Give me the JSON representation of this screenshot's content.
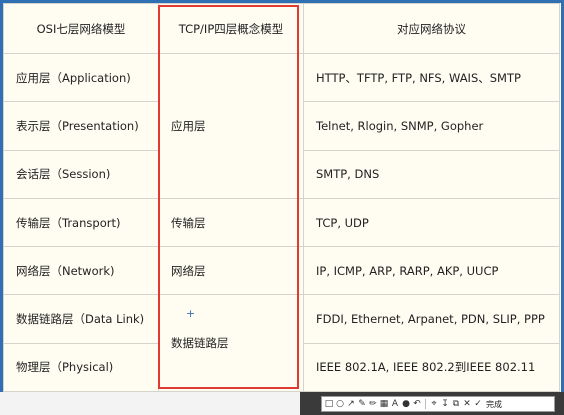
{
  "table": {
    "headers": [
      "OSI七层网络模型",
      "TCP/IP四层概念模型",
      "对应网络协议"
    ],
    "rows": [
      {
        "osi": "应用层（Application)",
        "protocols": "HTTP、TFTP, FTP, NFS, WAIS、SMTP"
      },
      {
        "osi": "表示层（Presentation)",
        "protocols": "Telnet, Rlogin, SNMP, Gopher"
      },
      {
        "osi": "会话层（Session)",
        "protocols": "SMTP, DNS"
      },
      {
        "osi": "传输层（Transport)",
        "protocols": "TCP, UDP"
      },
      {
        "osi": "网络层（Network)",
        "protocols": "IP, ICMP, ARP, RARP, AKP, UUCP"
      },
      {
        "osi": "数据链路层（Data Link)",
        "protocols": "FDDI, Ethernet, Arpanet, PDN, SLIP, PPP"
      },
      {
        "osi": "物理层（Physical)",
        "protocols": "IEEE 802.1A, IEEE 802.2到IEEE 802.11"
      }
    ],
    "tcpip": [
      "应用层",
      "传输层",
      "网络层",
      "数据链路层"
    ]
  },
  "cursor_glyph": "+",
  "highlight_color": "#e03b32",
  "toolbar": {
    "icons": [
      "rectangle-icon",
      "ellipse-icon",
      "arrow-icon",
      "pen-icon",
      "highlighter-icon",
      "mosaic-icon",
      "text-icon",
      "pin-icon",
      "undo-icon",
      "pin-to-screen-icon",
      "save-icon",
      "copy-icon",
      "cancel-icon",
      "done-icon"
    ],
    "done_label": "完成"
  }
}
